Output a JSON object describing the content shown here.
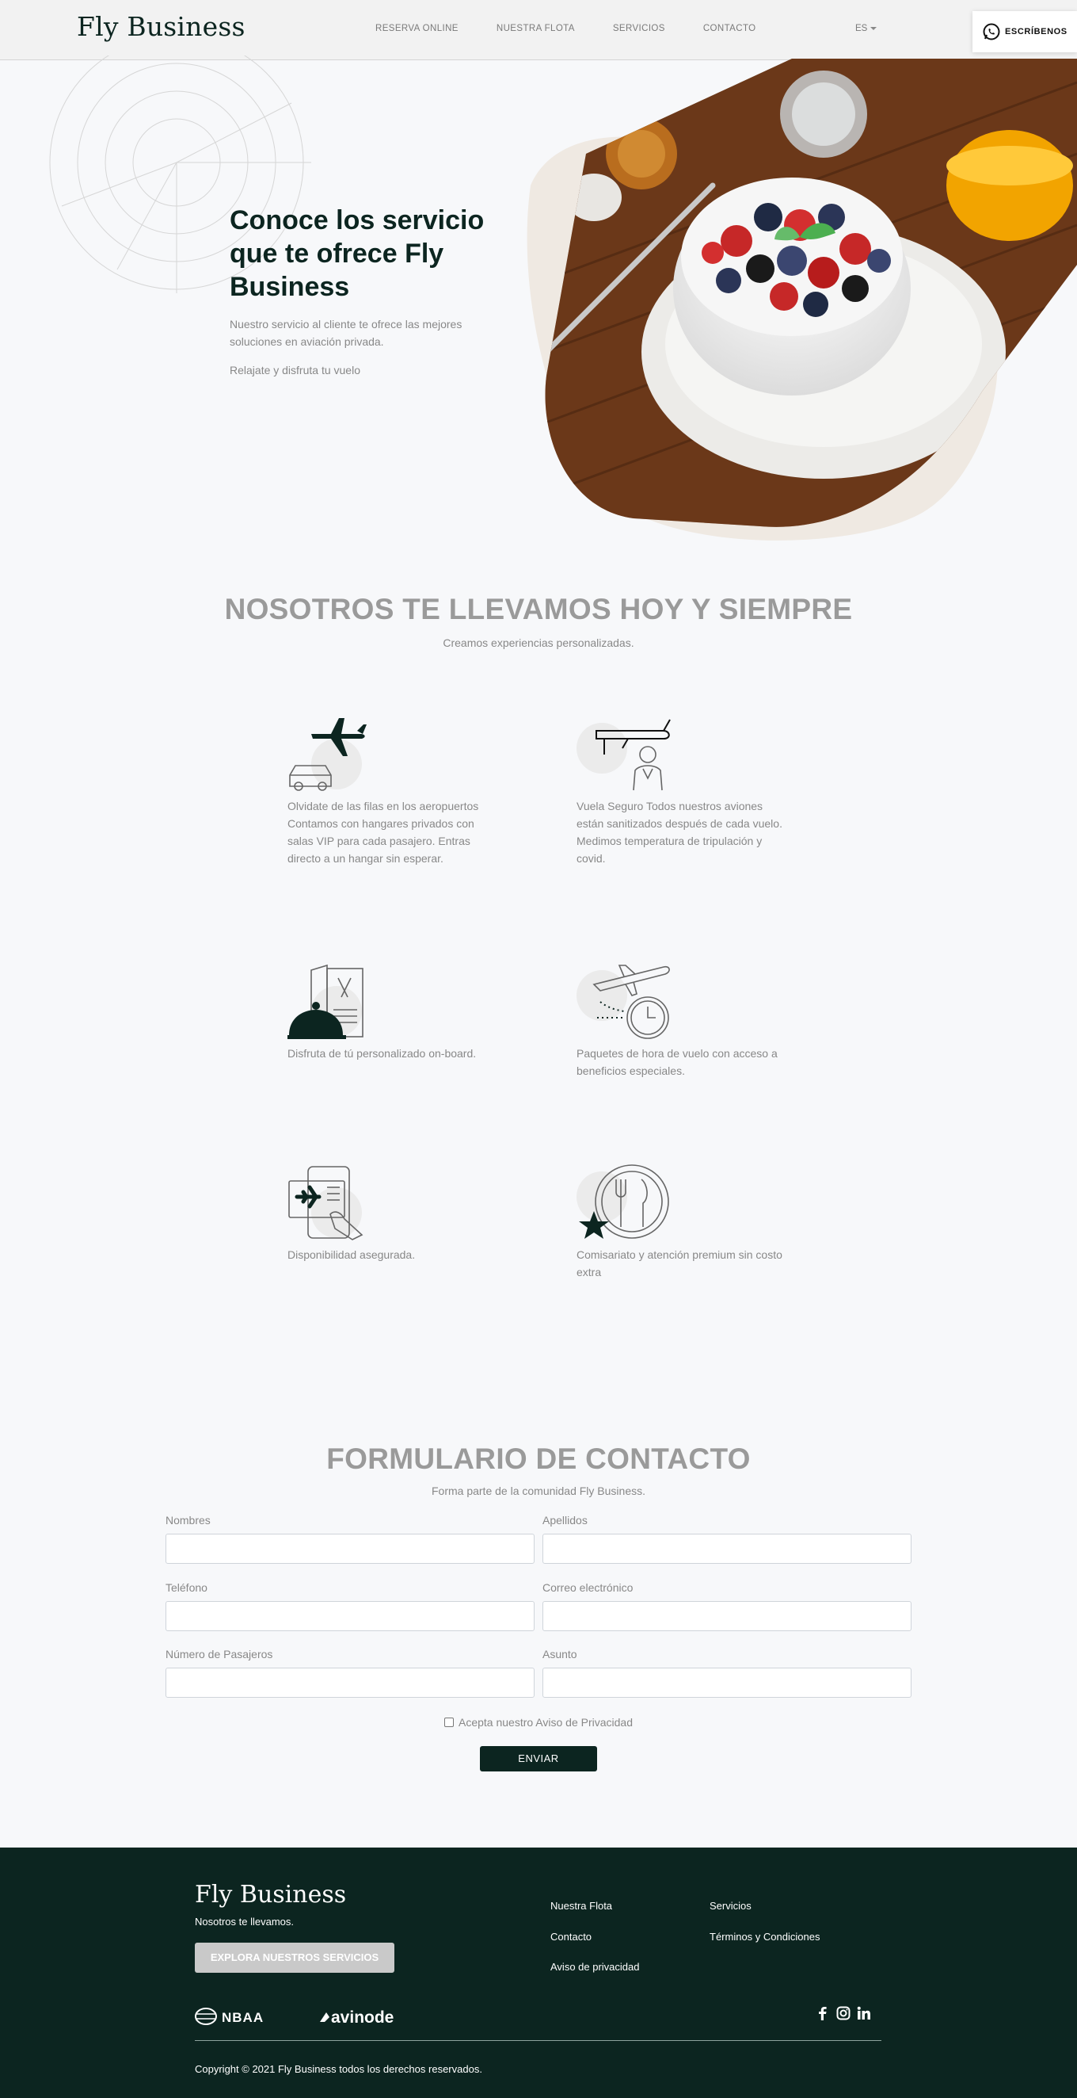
{
  "navbar": {
    "brand": "Fly Business",
    "links": [
      "RESERVA ONLINE",
      "NUESTRA FLOTA",
      "SERVICIOS",
      "CONTACTO"
    ],
    "language": "ES",
    "whatsapp_label": "ESCRÍBENOS"
  },
  "hero": {
    "title": "Conoce los servicio que te ofrece Fly Business",
    "subtitle": "Nuestro servicio al cliente te ofrece las mejores soluciones en aviación privada.",
    "subtitle2": "Relajate y disfruta tu vuelo"
  },
  "services": {
    "title": "NOSOTROS TE LLEVAMOS HOY Y SIEMPRE",
    "subtitle": "Creamos experiencias personalizadas.",
    "items": [
      {
        "icon": "plane-car-icon",
        "text": "Olvidate de las filas en los aeropuertos Contamos con hangares privados con salas VIP para cada pasajero. Entras directo a un hangar sin esperar."
      },
      {
        "icon": "plane-crew-icon",
        "text": "Vuela Seguro Todos nuestros aviones están sanitizados después de cada vuelo. Medimos temperatura de tripulación y covid."
      },
      {
        "icon": "onboard-meal-icon",
        "text": "Disfruta de tú personalizado on-board."
      },
      {
        "icon": "plane-clock-icon",
        "text": "Paquetes de hora de vuelo con acceso a beneficios especiales."
      },
      {
        "icon": "booking-phone-icon",
        "text": "Disponibilidad asegurada."
      },
      {
        "icon": "premium-dining-icon",
        "text": "Comisariato y atención premium sin costo extra"
      }
    ]
  },
  "contact": {
    "title": "FORMULARIO DE CONTACTO",
    "subtitle": "Forma parte de la comunidad Fly Business.",
    "fields": {
      "nombres": "Nombres",
      "apellidos": "Apellidos",
      "telefono": "Teléfono",
      "correo": "Correo electrónico",
      "pasajeros": "Número de Pasajeros",
      "asunto": "Asunto"
    },
    "privacy_label": "Acepta nuestro Aviso de Privacidad",
    "send_label": "ENVIAR"
  },
  "footer": {
    "brand": "Fly Business",
    "tagline": "Nosotros te llevamos.",
    "cta": "EXPLORA NUESTROS SERVICIOS",
    "links": {
      "flota": "Nuestra Flota",
      "contacto": "Contacto",
      "aviso": "Aviso de privacidad",
      "servicios": "Servicios",
      "terminos": "Términos y Condiciones"
    },
    "logo_nbaa": "NBAA",
    "logo_avinode": "avinode",
    "copyright": "Copyright © 2021 Fly Business todos los derechos reservados."
  },
  "colors": {
    "brand_dark": "#0c2520",
    "muted_gray": "#9a9a9a",
    "background": "#f7f8fa"
  }
}
